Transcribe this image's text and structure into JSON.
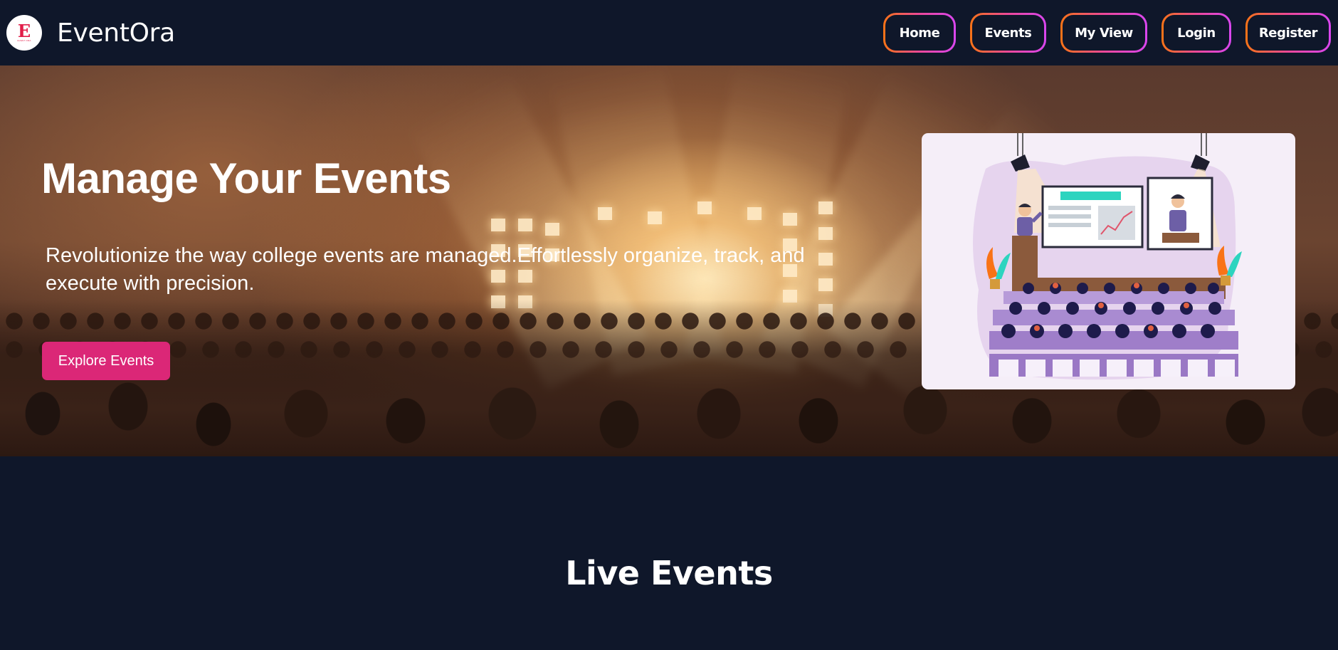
{
  "brand": {
    "logo_mark": "E",
    "logo_sub": "EVENT ORA",
    "name": "EventOra"
  },
  "nav": {
    "items": [
      {
        "label": "Home",
        "width": 102
      },
      {
        "label": "Events",
        "width": 107
      },
      {
        "label": "My View",
        "width": 122
      },
      {
        "label": "Login",
        "width": 98
      },
      {
        "label": "Register",
        "width": 120
      }
    ]
  },
  "hero": {
    "title": "Manage Your Events",
    "description": "Revolutionize the way college events are managed.Effortlessly organize, track, and execute with precision.",
    "cta_label": "Explore Events"
  },
  "live_events": {
    "title": "Live Events"
  },
  "colors": {
    "background": "#0f172a",
    "accent": "#db2777",
    "nav_border_start": "#f97316",
    "nav_border_end": "#d946ef"
  }
}
